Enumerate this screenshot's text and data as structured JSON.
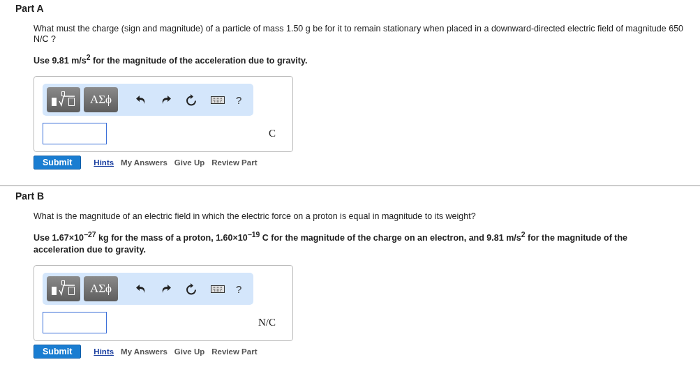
{
  "parts": [
    {
      "title": "Part A",
      "question": "What must the charge (sign and magnitude) of a particle of mass 1.50 g be for it to remain stationary when placed in a downward-directed electric field of magnitude 650 N/C ?",
      "given": "Use 9.81 m/s$^{2}$ for the magnitude of the acceleration due to gravity.",
      "toolbar": {
        "symbols": "ΑΣϕ",
        "help": "?"
      },
      "unit": "C",
      "submit": "Submit",
      "links": [
        {
          "label": "Hints",
          "kind": "primary"
        },
        {
          "label": "My Answers",
          "kind": "secondary"
        },
        {
          "label": "Give Up",
          "kind": "secondary"
        },
        {
          "label": "Review Part",
          "kind": "secondary"
        }
      ]
    },
    {
      "title": "Part B",
      "question": "What is the magnitude of an electric field in which the electric force on a proton is equal in magnitude to its weight?",
      "given": "Use 1.67×10$^{−27}$ kg for the mass of a proton, 1.60×10$^{−19}$ C for the magnitude of the charge on an electron, and 9.81 m/s$^{2}$ for the magnitude of the acceleration due to gravity.",
      "toolbar": {
        "symbols": "ΑΣϕ",
        "help": "?"
      },
      "unit": "N/C",
      "submit": "Submit",
      "links": [
        {
          "label": "Hints",
          "kind": "primary"
        },
        {
          "label": "My Answers",
          "kind": "secondary"
        },
        {
          "label": "Give Up",
          "kind": "secondary"
        },
        {
          "label": "Review Part",
          "kind": "secondary"
        }
      ]
    }
  ]
}
